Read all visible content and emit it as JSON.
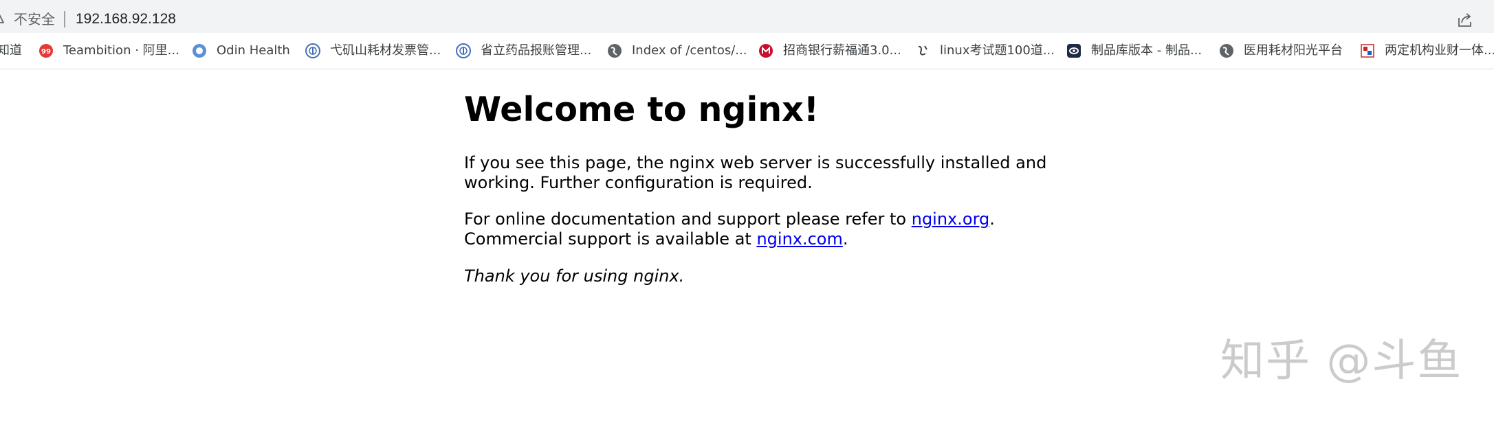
{
  "address_bar": {
    "security_label": "不安全",
    "url": "192.168.92.128"
  },
  "bookmarks": [
    {
      "label": "知道",
      "icon": "none"
    },
    {
      "label": "Teambition · 阿里...",
      "icon": "teambition-icon"
    },
    {
      "label": "Odin Health",
      "icon": "odin-health-icon"
    },
    {
      "label": "弋矶山耗材发票管...",
      "icon": "hospital-logo-icon"
    },
    {
      "label": "省立药品报账管理...",
      "icon": "hospital-logo-icon"
    },
    {
      "label": "Index of /centos/...",
      "icon": "globe-icon"
    },
    {
      "label": "招商银行薪福通3.0...",
      "icon": "cmb-logo-icon"
    },
    {
      "label": "linux考试题100道...",
      "icon": "linux-icon"
    },
    {
      "label": "制品库版本 - 制品...",
      "icon": "artifact-repo-icon"
    },
    {
      "label": "医用耗材阳光平台",
      "icon": "globe-icon"
    },
    {
      "label": "两定机构业财一体...",
      "icon": "finance-icon"
    }
  ],
  "page": {
    "title": "Welcome to nginx!",
    "para1_line1": "If you see this page, the nginx web server is successfully installed and",
    "para1_line2": "working. Further configuration is required.",
    "para2_line1_prefix": "For online documentation and support please refer to ",
    "para2_link1": "nginx.org",
    "para2_line1_suffix": ".",
    "para2_line2_prefix": "Commercial support is available at ",
    "para2_link2": "nginx.com",
    "para2_line2_suffix": ".",
    "thanks": "Thank you for using nginx."
  },
  "watermark": "知乎 @斗鱼",
  "colors": {
    "link": "#0000ee",
    "toolbar_bg": "#f1f3f4"
  }
}
